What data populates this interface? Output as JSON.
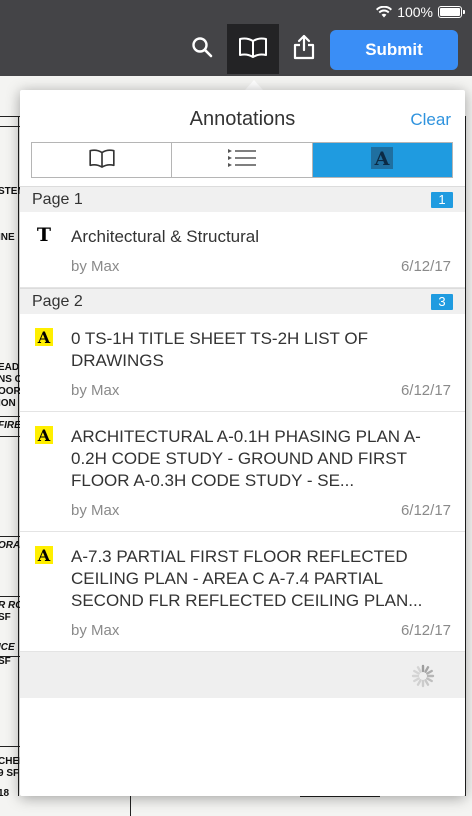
{
  "status": {
    "battery_text": "100%",
    "battery_level": 1.0
  },
  "toolbar": {
    "search_icon": "search-icon",
    "annotations_icon": "open-book-icon",
    "share_icon": "share-icon",
    "submit_label": "Submit",
    "accent_color": "#3a8ef6"
  },
  "popover": {
    "title": "Annotations",
    "clear_label": "Clear",
    "tabs": [
      {
        "icon": "open-book-icon",
        "active": false
      },
      {
        "icon": "list-icon",
        "active": false
      },
      {
        "icon": "annotation-a-icon",
        "active": true
      }
    ],
    "sections": [
      {
        "label": "Page 1",
        "count": "1",
        "items": [
          {
            "icon": "T",
            "text": "Architectural & Structural",
            "author": "by Max",
            "date": "6/12/17"
          }
        ]
      },
      {
        "label": "Page 2",
        "count": "3",
        "items": [
          {
            "icon": "A",
            "text": "0 TS-1H TITLE SHEET TS-2H LIST OF DRAWINGS",
            "author": "by Max",
            "date": "6/12/17"
          },
          {
            "icon": "A",
            "text": "ARCHITECTURAL A-0.1H PHASING PLAN A-0.2H CODE STUDY - GROUND AND FIRST FLOOR A-0.3H CODE STUDY - SE...",
            "author": "by Max",
            "date": "6/12/17"
          },
          {
            "icon": "A",
            "text": "A-7.3 PARTIAL FIRST FLOOR REFLECTED CEILING PLAN - AREA C A-7.4 PARTIAL SECOND FLR REFLECTED CEILING PLAN...",
            "author": "by Max",
            "date": "6/12/17"
          }
        ]
      }
    ]
  },
  "background_doc": {
    "fragments": [
      "STEM",
      "INE",
      "EAD S",
      "NS O",
      "OOR",
      "ION",
      "FIRE",
      "ORA",
      "R RO",
      "SF",
      "ICE",
      "SF",
      "CHEN",
      "9 SF",
      "18"
    ]
  }
}
